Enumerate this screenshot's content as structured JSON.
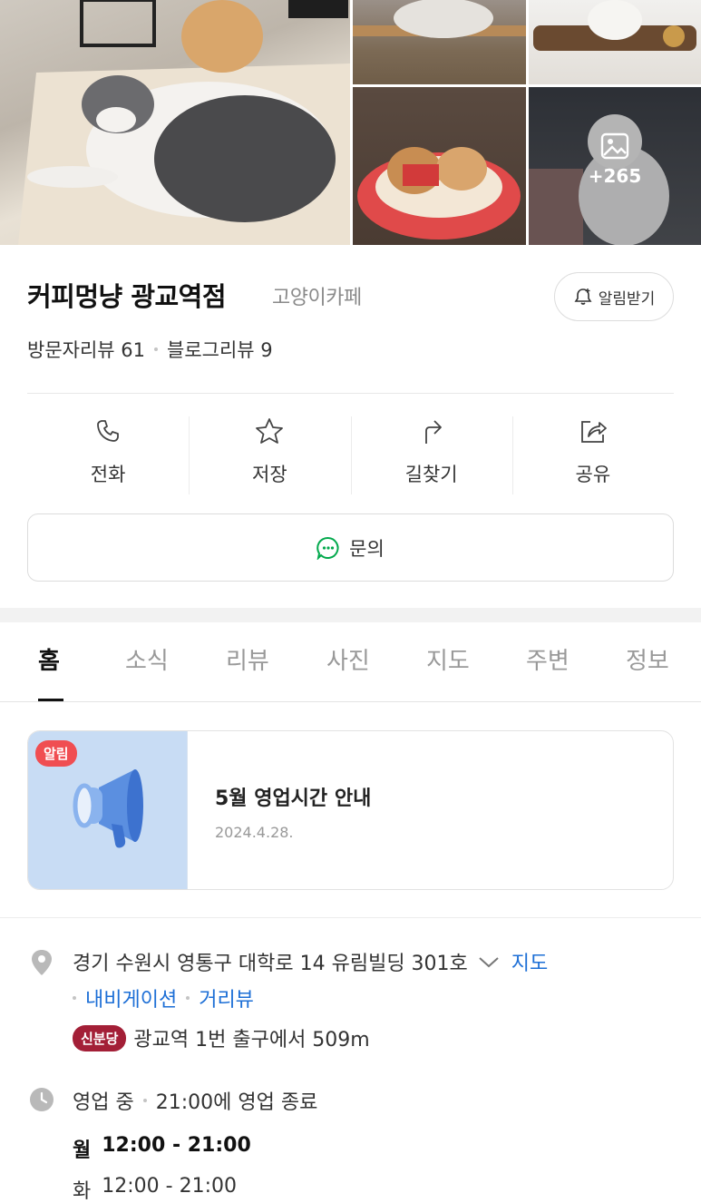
{
  "photos": {
    "more_count": "+265"
  },
  "place": {
    "name": "커피멍냥 광교역점",
    "category": "고양이카페",
    "alarm_label": "알림받기",
    "visitor_reviews": "방문자리뷰 61",
    "blog_reviews": "블로그리뷰 9"
  },
  "actions": [
    {
      "label": "전화",
      "icon": "phone-icon"
    },
    {
      "label": "저장",
      "icon": "star-icon"
    },
    {
      "label": "길찾기",
      "icon": "directions-icon"
    },
    {
      "label": "공유",
      "icon": "share-icon"
    }
  ],
  "inquiry_label": "문의",
  "tabs": [
    "홈",
    "소식",
    "리뷰",
    "사진",
    "지도",
    "주변",
    "정보"
  ],
  "active_tab": "홈",
  "notice": {
    "badge": "알림",
    "title": "5월 영업시간 안내",
    "date": "2024.4.28."
  },
  "info": {
    "address": "경기 수원시 영통구 대학로 14 유림빌딩 301호",
    "map_link": "지도",
    "navigation_link": "내비게이션",
    "street_view_link": "거리뷰",
    "subway_line": "신분당",
    "subway_text": "광교역 1번 출구에서 509m",
    "status": "영업 중",
    "closing_text": "21:00에 영업 종료",
    "hours": [
      {
        "day": "월",
        "time": "12:00 - 21:00"
      },
      {
        "day": "화",
        "time": "12:00 - 21:00"
      }
    ]
  },
  "colors": {
    "accent_blue": "#1d6fd6",
    "notice_badge": "#f04e52",
    "subway_badge": "#a31f37",
    "inquiry_green": "#03a94d"
  }
}
